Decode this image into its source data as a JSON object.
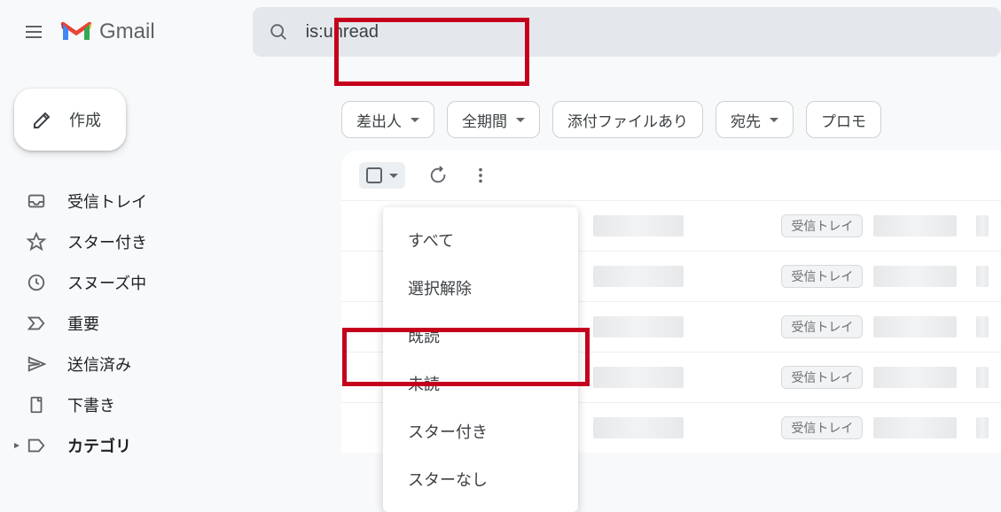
{
  "header": {
    "app_name": "Gmail",
    "search_value": "is:unread"
  },
  "sidebar": {
    "compose_label": "作成",
    "items": [
      {
        "label": "受信トレイ",
        "icon": "inbox"
      },
      {
        "label": "スター付き",
        "icon": "star"
      },
      {
        "label": "スヌーズ中",
        "icon": "clock"
      },
      {
        "label": "重要",
        "icon": "important"
      },
      {
        "label": "送信済み",
        "icon": "send"
      },
      {
        "label": "下書き",
        "icon": "draft"
      },
      {
        "label": "カテゴリ",
        "icon": "label",
        "bold": true,
        "expand": true
      }
    ]
  },
  "chips": [
    {
      "label": "差出人",
      "dropdown": true
    },
    {
      "label": "全期間",
      "dropdown": true
    },
    {
      "label": "添付ファイルあり",
      "dropdown": false
    },
    {
      "label": "宛先",
      "dropdown": true
    },
    {
      "label": "プロモ",
      "dropdown": false
    }
  ],
  "select_menu": {
    "items": [
      "すべて",
      "選択解除",
      "既読",
      "未読",
      "スター付き",
      "スターなし"
    ]
  },
  "mail": {
    "inbox_label": "受信トレイ",
    "rows": 5
  },
  "highlights": {
    "search": true,
    "menu_item_index": 3
  }
}
